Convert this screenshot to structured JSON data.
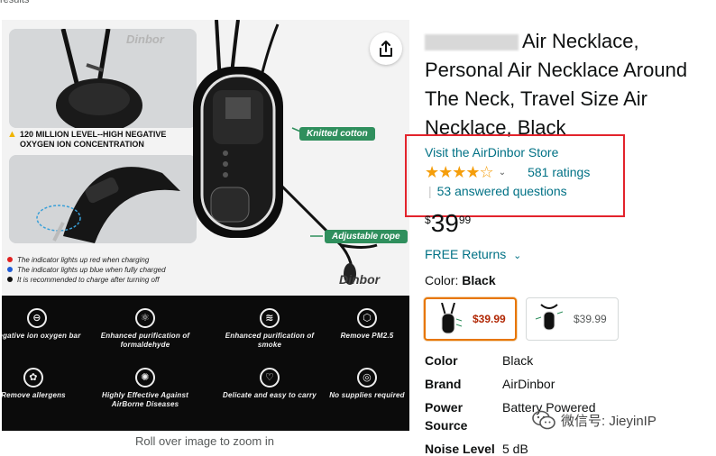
{
  "results_stub": "results",
  "image": {
    "brand_mark": "Dinbor",
    "callout": "120 MILLION LEVEL--HIGH NEGATIVE OXYGEN ION CONCENTRATION",
    "legend": [
      {
        "text": "The indicator lights up red when charging",
        "color": "#e02020"
      },
      {
        "text": "The indicator lights up blue when fully charged",
        "color": "#1f5bd6"
      },
      {
        "text": "It is recommended to charge after turning off",
        "color": "#111111"
      }
    ],
    "tag_cotton": "Knitted cotton",
    "tag_rope": "Adjustable rope",
    "features": [
      {
        "label": "Negative ion oxygen bar",
        "icon": "ion-icon",
        "glyph": "⊖"
      },
      {
        "label": "Enhanced purification of formaldehyde",
        "icon": "molecule-icon",
        "glyph": "⚛"
      },
      {
        "label": "Enhanced purification of smoke",
        "icon": "cigarette-icon",
        "glyph": "≋"
      },
      {
        "label": "Remove PM2.5",
        "icon": "pm25-icon",
        "glyph": "⬡"
      },
      {
        "label": "Remove allergens",
        "icon": "allergen-icon",
        "glyph": "✿"
      },
      {
        "label": "Highly Effective Against AirBorne Diseases",
        "icon": "virus-icon",
        "glyph": "✺"
      },
      {
        "label": "Delicate and easy to carry",
        "icon": "necklace-icon",
        "glyph": "♡"
      },
      {
        "label": "No supplies required",
        "icon": "no-supplies-icon",
        "glyph": "◎"
      }
    ],
    "zoom_hint": "Roll over image to zoom in"
  },
  "product": {
    "title": "Air Necklace, Personal Air Necklace Around The Neck, Travel Size Air Necklace, Black",
    "store_link": "Visit the AirDinbor Store",
    "stars": "★★★★☆",
    "ratings": "581 ratings",
    "qa_sep": "|",
    "qa": "53 answered questions",
    "price_currency": "$",
    "price_whole": "39",
    "price_fraction": "99",
    "returns": "FREE Returns",
    "returns_caret": "⌄",
    "color_label": "Color:",
    "color_value": "Black",
    "swatches": [
      {
        "price": "$39.99",
        "selected": true
      },
      {
        "price": "$39.99",
        "selected": false
      }
    ],
    "specs": [
      {
        "key": "Color",
        "value": "Black"
      },
      {
        "key": "Brand",
        "value": "AirDinbor"
      },
      {
        "key": "Power Source",
        "value": "Battery Powered"
      },
      {
        "key": "Noise Level",
        "value": "5 dB"
      }
    ]
  },
  "watermark": "微信号: JieyinIP",
  "colors": {
    "link": "#007185",
    "star": "#f59e0b",
    "highlight_box": "#e3232c",
    "tag_green": "#2f8f5d",
    "selected_swatch": "#e77600"
  }
}
